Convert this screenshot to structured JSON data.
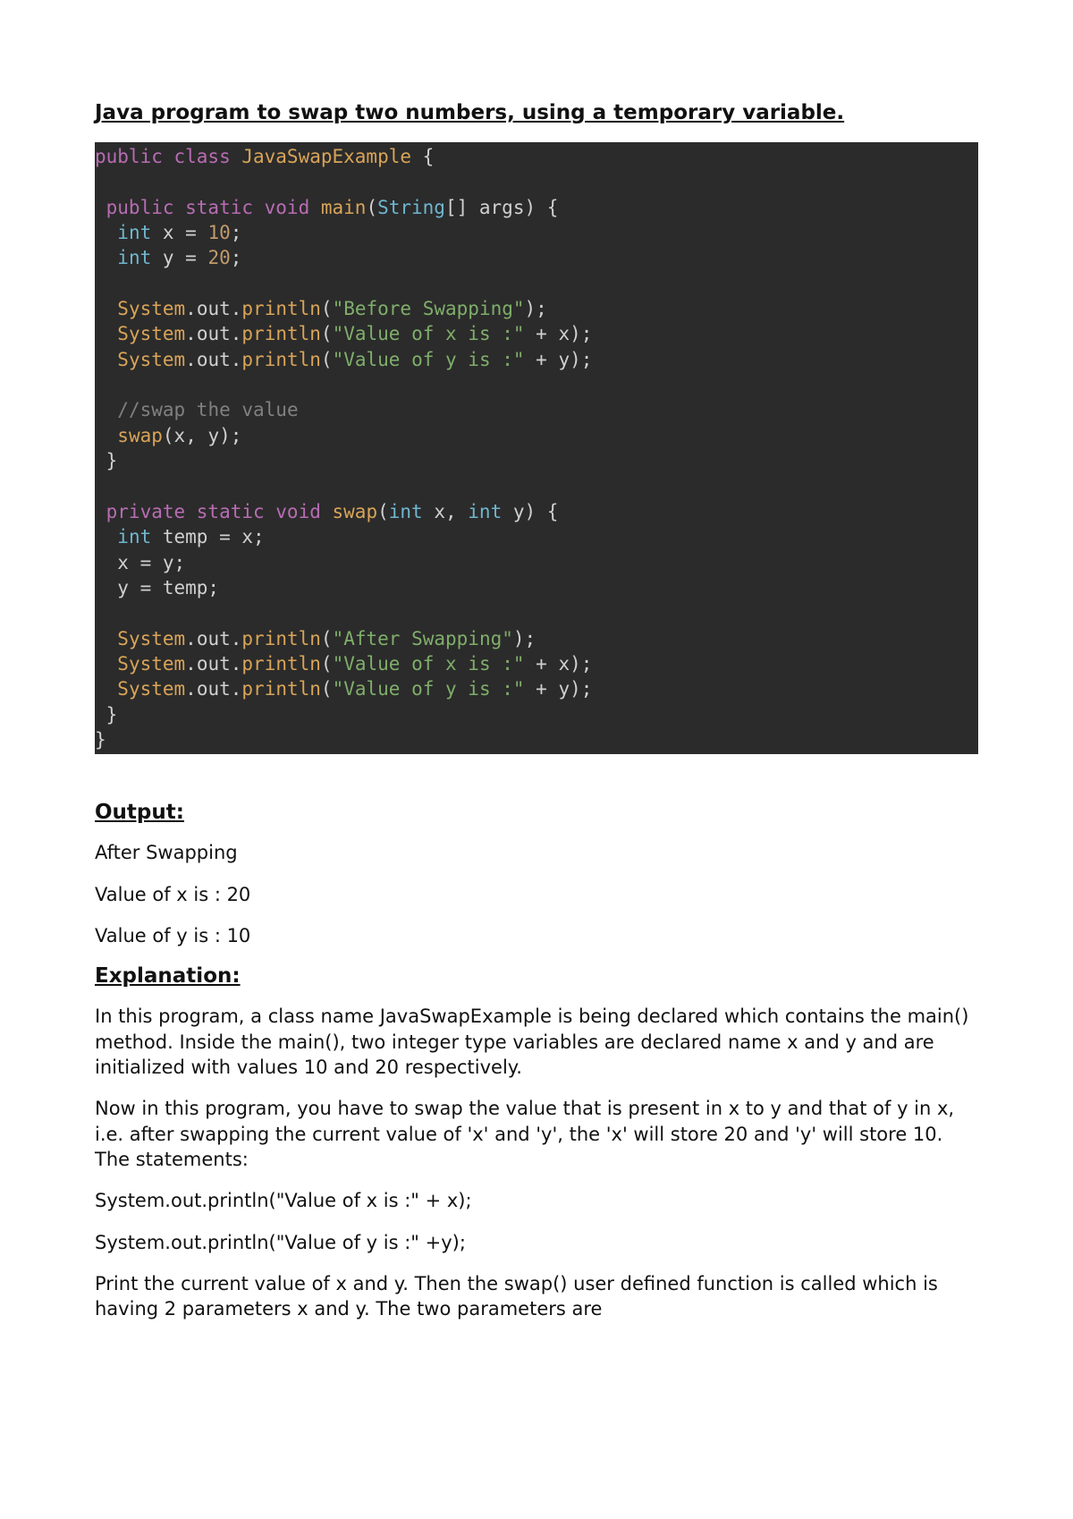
{
  "title": " Java program to swap two numbers, using a temporary variable.",
  "code": {
    "line1": {
      "kw1": "public class",
      "cls": " JavaSwapExample",
      "pun": " {"
    },
    "line2": "",
    "line3": {
      "kw1": " public static void",
      "fn": " main",
      "pun1": "(",
      "type": "String",
      "pun2": "[] ",
      "id": "args",
      "pun3": ") {"
    },
    "line4": {
      "sp": "  ",
      "type": "int",
      "id1": " x ",
      "op": "=",
      "sp2": " ",
      "num": "10",
      "pun": ";"
    },
    "line5": {
      "sp": "  ",
      "type": "int",
      "id1": " y ",
      "op": "=",
      "sp2": " ",
      "num": "20",
      "pun": ";"
    },
    "line6": "",
    "line7": {
      "sp": "  ",
      "cls": "System",
      "dot1": ".",
      "id": "out",
      "dot2": ".",
      "fn": "println",
      "p1": "(",
      "str": "\"Before Swapping\"",
      "p2": ");"
    },
    "line8": {
      "sp": "  ",
      "cls": "System",
      "dot1": ".",
      "id": "out",
      "dot2": ".",
      "fn": "println",
      "p1": "(",
      "str": "\"Value of x is :\"",
      "plus": " + ",
      "var": "x",
      "p2": ");"
    },
    "line9": {
      "sp": "  ",
      "cls": "System",
      "dot1": ".",
      "id": "out",
      "dot2": ".",
      "fn": "println",
      "p1": "(",
      "str": "\"Value of y is :\"",
      "plus": " + ",
      "var": "y",
      "p2": ");"
    },
    "line10": "",
    "line11": {
      "sp": "  ",
      "cmt": "//swap the value"
    },
    "line12": {
      "sp": "  ",
      "fn": "swap",
      "p1": "(",
      "a1": "x",
      "c": ", ",
      "a2": "y",
      "p2": ");"
    },
    "line13": " }",
    "line14": "",
    "line15": {
      "kw1": " private static void",
      "fn": " swap",
      "p1": "(",
      "t1": "int",
      "a1": " x",
      "c": ", ",
      "t2": "int",
      "a2": " y",
      "p2": ") {"
    },
    "line16": {
      "sp": "  ",
      "type": "int",
      "rest": " temp = x;"
    },
    "line17": "  x = y;",
    "line18": "  y = temp;",
    "line19": "",
    "line20": {
      "sp": "  ",
      "cls": "System",
      "dot1": ".",
      "id": "out",
      "dot2": ".",
      "fn": "println",
      "p1": "(",
      "str": "\"After Swapping\"",
      "p2": ");"
    },
    "line21": {
      "sp": "  ",
      "cls": "System",
      "dot1": ".",
      "id": "out",
      "dot2": ".",
      "fn": "println",
      "p1": "(",
      "str": "\"Value of x is :\"",
      "plus": " + ",
      "var": "x",
      "p2": ");"
    },
    "line22": {
      "sp": "  ",
      "cls": "System",
      "dot1": ".",
      "id": "out",
      "dot2": ".",
      "fn": "println",
      "p1": "(",
      "str": "\"Value of y is :\"",
      "plus": " + ",
      "var": "y",
      "p2": ");"
    },
    "line23": " }",
    "line24": "}"
  },
  "output_heading": "Output:",
  "output_lines": {
    "o1": "After Swapping",
    "o2": "Value of x is : 20",
    "o3": "Value of y is : 10"
  },
  "explanation_heading": "Explanation:",
  "explanation": {
    "p1": "In this program, a class name JavaSwapExample is being declared which contains the main() method. Inside the main(), two integer type variables are declared name x and y and are initialized with values 10 and 20 respectively.",
    "p2": "Now in this program, you have to swap the value that is present in x to y and that of y in x, i.e. after swapping the current value of 'x' and 'y', the 'x' will store 20 and 'y' will store 10. The statements:",
    "p3": "System.out.println(\"Value of x is :\" + x);",
    "p4": "System.out.println(\"Value of y is :\" +y);",
    "p5": "Print the current value of x and y. Then the swap() user defined function is called which is having 2 parameters x and y. The two parameters are"
  }
}
